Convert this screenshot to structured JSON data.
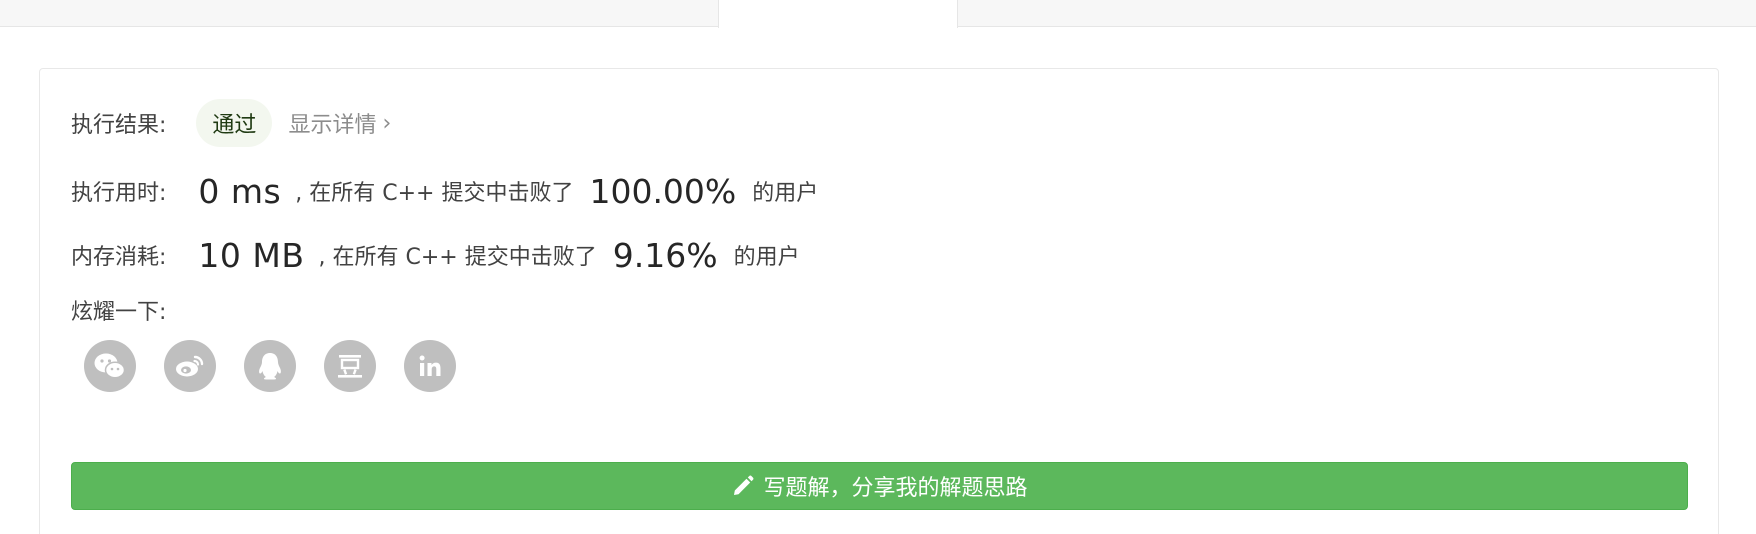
{
  "tabs": {
    "active_label": ""
  },
  "result": {
    "label": "执行结果:",
    "status": "通过",
    "details_label": "显示详情",
    "details_chevron": "›"
  },
  "runtime": {
    "label": "执行用时:",
    "value": "0 ms",
    "middle": ", 在所有 C++ 提交中击败了",
    "percent": "100.00%",
    "tail": "的用户"
  },
  "memory": {
    "label": "内存消耗:",
    "value": "10 MB",
    "middle": ", 在所有 C++ 提交中击败了",
    "percent": "9.16%",
    "tail": "的用户"
  },
  "share": {
    "label": "炫耀一下:",
    "icons": [
      "wechat-icon",
      "weibo-icon",
      "qq-icon",
      "douban-icon",
      "linkedin-icon"
    ]
  },
  "write_button": {
    "label": "写题解，分享我的解题思路",
    "icon": "pencil-icon"
  },
  "colors": {
    "success_green": "#5cb85c",
    "pill_bg": "#f3f7ef",
    "icon_gray": "#bfbfbf"
  }
}
